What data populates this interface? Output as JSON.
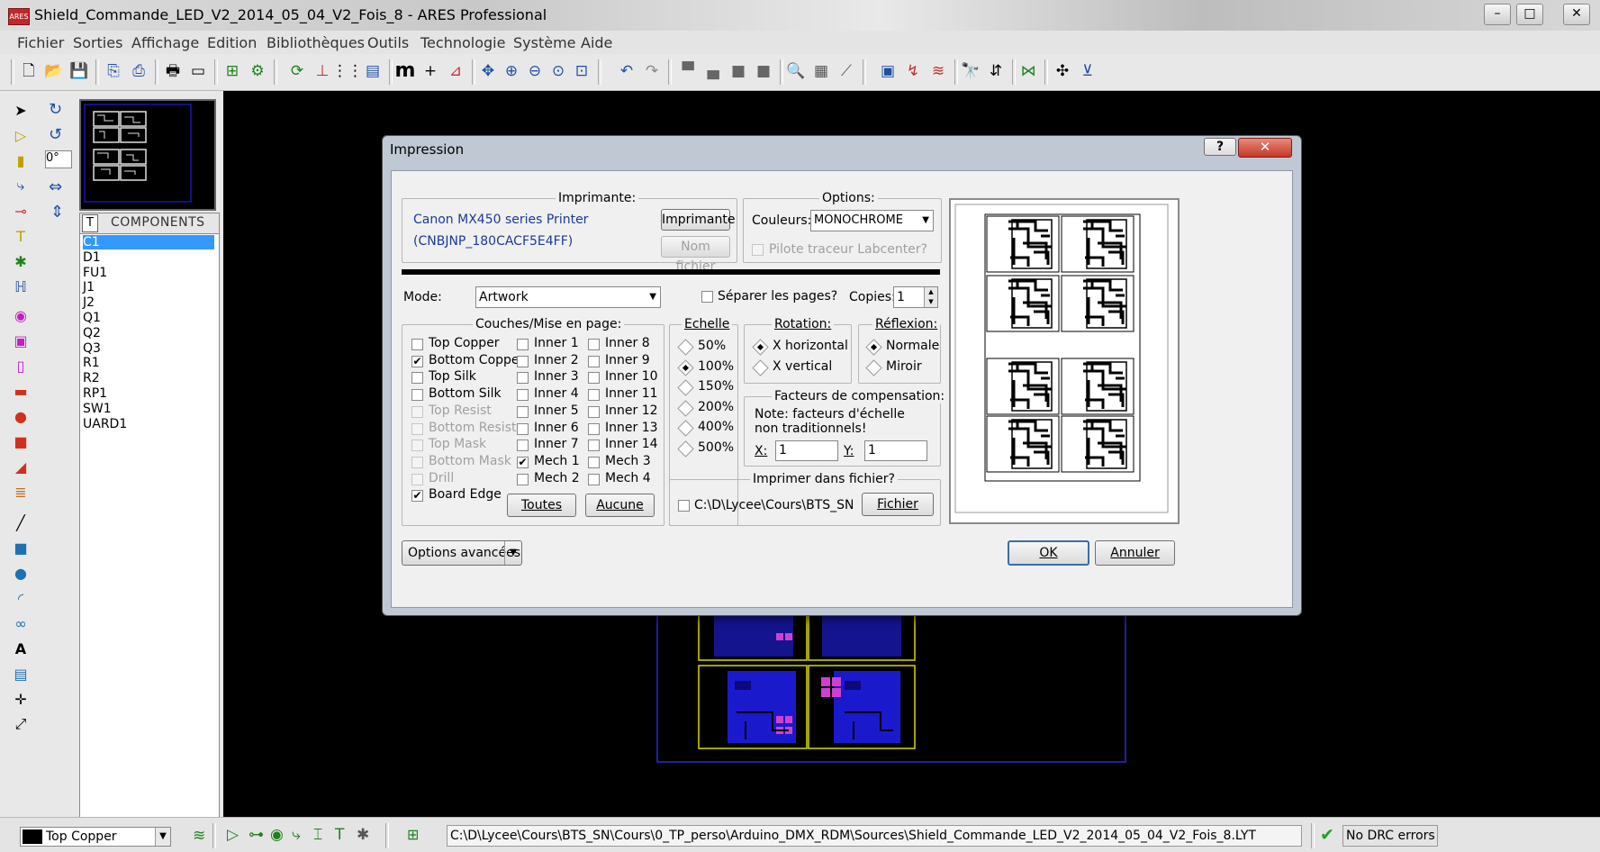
{
  "window": {
    "app_icon_text": "ARES",
    "title": "Shield_Commande_LED_V2_2014_05_04_V2_Fois_8 - ARES Professional",
    "btn_minimize": "–",
    "btn_maximize": "□",
    "btn_close": "✕"
  },
  "menu": [
    "Fichier",
    "Sorties",
    "Affichage",
    "Edition",
    "Bibliothèques",
    "Outils",
    "Technologie",
    "Système",
    "Aide"
  ],
  "toolbar": {
    "icons": [
      "new-file-icon",
      "open-folder-icon",
      "save-icon",
      "import-icon",
      "export-icon",
      "print-icon",
      "print-area-icon",
      "netlist-icon",
      "design-explorer-icon",
      "refresh-icon",
      "origin-icon",
      "grid-icon",
      "layers-icon",
      "metric-icon",
      "false-origin-icon",
      "snap-icon",
      "pan-icon",
      "zoom-in-icon",
      "zoom-out-icon",
      "zoom-all-icon",
      "zoom-area-icon",
      "undo-icon",
      "redo-icon",
      "block-copy-icon",
      "block-move-icon",
      "block-rotate-icon",
      "block-delete-icon",
      "pick-part-icon",
      "make-package-icon",
      "decompose-icon",
      "autoplace-icon",
      "autoroute-icon",
      "tidy-icon",
      "search-tag-icon",
      "rename-icon",
      "ratsnest-icon",
      "power-plane-icon",
      "drc-icon"
    ]
  },
  "left_tools": {
    "rotation_value": "0°",
    "icons": [
      "selection-icon",
      "component-icon",
      "package-icon",
      "track-icon",
      "via-icon",
      "zone-icon",
      "ratsnest-icon",
      "connectivity-icon",
      "round-pad-icon",
      "square-pad-icon",
      "dil-pad-icon",
      "edge-pad-icon",
      "circle-pad-icon",
      "smt-pad-icon",
      "polygon-pad-icon",
      "padstack-icon",
      "line-icon",
      "box-icon",
      "circle-icon",
      "arc-icon",
      "path-icon",
      "text-icon",
      "symbol-icon",
      "marker-icon",
      "dimension-icon"
    ]
  },
  "components_panel": {
    "tab_label": "T",
    "header": "COMPONENTS",
    "items": [
      "C1",
      "D1",
      "FU1",
      "J1",
      "J2",
      "Q1",
      "Q2",
      "Q3",
      "R1",
      "R2",
      "RP1",
      "SW1",
      "UARD1"
    ],
    "selected_index": 0
  },
  "dialog": {
    "title": "Impression",
    "help_button": "?",
    "close_button": "✕",
    "printer_group": {
      "title": "Imprimante:",
      "printer_name": "Canon MX450 series Printer",
      "printer_port": "(CNBJNP_180CACF5E4FF)",
      "printer_button": "Imprimante",
      "filename_button": "Nom fichier"
    },
    "options_group": {
      "title": "Options:",
      "colors_label": "Couleurs:",
      "colors_value": "MONOCHROME",
      "plotter_label": "Pilote traceur Labcenter?"
    },
    "mode_label": "Mode:",
    "mode_value": "Artwork",
    "separate_pages_label": "Séparer les pages?",
    "copies_label": "Copies:",
    "copies_value": "1",
    "layers_group": {
      "title": "Couches/Mise en page:",
      "col1": [
        {
          "label": "Top Copper",
          "checked": false,
          "enabled": true
        },
        {
          "label": "Bottom Copper",
          "checked": true,
          "enabled": true
        },
        {
          "label": "Top Silk",
          "checked": false,
          "enabled": true
        },
        {
          "label": "Bottom Silk",
          "checked": false,
          "enabled": true
        },
        {
          "label": "Top Resist",
          "checked": false,
          "enabled": false
        },
        {
          "label": "Bottom Resist",
          "checked": false,
          "enabled": false
        },
        {
          "label": "Top Mask",
          "checked": false,
          "enabled": false
        },
        {
          "label": "Bottom Mask",
          "checked": false,
          "enabled": false
        },
        {
          "label": "Drill",
          "checked": false,
          "enabled": false
        },
        {
          "label": "Board Edge",
          "checked": true,
          "enabled": true
        }
      ],
      "col2": [
        {
          "label": "Inner 1",
          "checked": false
        },
        {
          "label": "Inner 2",
          "checked": false
        },
        {
          "label": "Inner 3",
          "checked": false
        },
        {
          "label": "Inner 4",
          "checked": false
        },
        {
          "label": "Inner 5",
          "checked": false
        },
        {
          "label": "Inner 6",
          "checked": false
        },
        {
          "label": "Inner 7",
          "checked": false
        },
        {
          "label": "Mech 1",
          "checked": true
        },
        {
          "label": "Mech 2",
          "checked": false
        }
      ],
      "col3": [
        {
          "label": "Inner 8",
          "checked": false
        },
        {
          "label": "Inner 9",
          "checked": false
        },
        {
          "label": "Inner 10",
          "checked": false
        },
        {
          "label": "Inner 11",
          "checked": false
        },
        {
          "label": "Inner 12",
          "checked": false
        },
        {
          "label": "Inner 13",
          "checked": false
        },
        {
          "label": "Inner 14",
          "checked": false
        },
        {
          "label": "Mech 3",
          "checked": false
        },
        {
          "label": "Mech 4",
          "checked": false
        }
      ],
      "all_button": "Toutes",
      "none_button": "Aucune"
    },
    "scale_group": {
      "title": "Echelle",
      "options": [
        {
          "label": "50%",
          "selected": false
        },
        {
          "label": "100%",
          "selected": true
        },
        {
          "label": "150%",
          "selected": false
        },
        {
          "label": "200%",
          "selected": false
        },
        {
          "label": "400%",
          "selected": false
        },
        {
          "label": "500%",
          "selected": false
        }
      ]
    },
    "rotation_group": {
      "title": "Rotation:",
      "options": [
        {
          "label": "X horizontal",
          "selected": true
        },
        {
          "label": "X vertical",
          "selected": false
        }
      ]
    },
    "reflection_group": {
      "title": "Réflexion:",
      "options": [
        {
          "label": "Normale",
          "selected": true
        },
        {
          "label": "Miroir",
          "selected": false
        }
      ]
    },
    "compensation_group": {
      "title": "Facteurs de compensation:",
      "note": "Note: facteurs d'échelle non traditionnels!",
      "x_label": "X:",
      "x_value": "1",
      "y_label": "Y:",
      "y_value": "1"
    },
    "print_to_file_group": {
      "title": "Imprimer dans fichier?",
      "path": "C:\\D\\Lycee\\Cours\\BTS_SN\\Co",
      "file_button": "Fichier"
    },
    "advanced_button": "Options avancées",
    "ok_button": "OK",
    "cancel_button": "Annuler"
  },
  "statusbar": {
    "layer_value": "Top Copper",
    "layer_color": "#000000",
    "filepath": "C:\\D\\Lycee\\Cours\\BTS_SN\\Cours\\0_TP_perso\\Arduino_DMX_RDM\\Sources\\Shield_Commande_LED_V2_2014_05_04_V2_Fois_8.LYT",
    "drc_status": "No DRC errors"
  },
  "colors": {
    "workspace": "#000000",
    "board_outline": "#d8d800",
    "copper_bottom": "#1a1acc",
    "pads": "#d040d0",
    "selection": "#3399ff"
  }
}
